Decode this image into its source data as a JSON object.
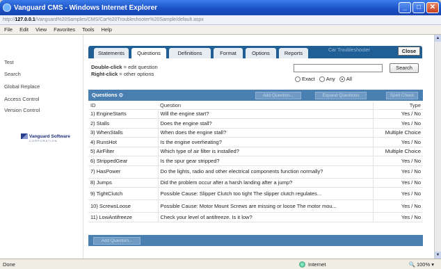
{
  "window": {
    "title": "Vanguard CMS - Windows Internet Explorer"
  },
  "address": {
    "prefix": "http://",
    "host": "127.0.0.1",
    "path": "/Vanguard%20Samples/CMS/Car%20Troubleshooter%20Sample/default.aspx"
  },
  "menu": [
    "File",
    "Edit",
    "View",
    "Favorites",
    "Tools",
    "Help"
  ],
  "sidebar": {
    "items": [
      "Test",
      "Search",
      "Global Replace",
      "Access Control",
      "Version Control"
    ],
    "logo_name": "Vanguard Software",
    "logo_sub": "CORPORATION"
  },
  "tabs": [
    "Statements",
    "Questions",
    "Definitions",
    "Format",
    "Options",
    "Reports"
  ],
  "active_tab": "Questions",
  "header_right": {
    "title": "Car Troubleshooter",
    "close_label": "Close"
  },
  "hints": {
    "line1_bold": "Double-click",
    "line1_rest": " = edit question",
    "line2_bold": "Right-click",
    "line2_rest": " = other options"
  },
  "search": {
    "button": "Search",
    "value": "",
    "options": [
      "Exact",
      "Any",
      "All"
    ],
    "selected": "All"
  },
  "questions_panel": {
    "title": "Questions",
    "buttons": [
      "Add Question...",
      "Expand Questions",
      "Spell Check"
    ],
    "columns": [
      "ID",
      "Question",
      "Type"
    ],
    "rows": [
      {
        "id": "1)  EngineStarts",
        "q": "Will the engine start?",
        "type": "Yes / No"
      },
      {
        "id": "2)  Stalls",
        "q": "Does the engine stall?",
        "type": "Yes / No"
      },
      {
        "id": "3)  WhenStalls",
        "q": "When does the engine stall?",
        "type": "Multiple Choice"
      },
      {
        "id": "4)  RunsHot",
        "q": "Is the engine overheating?",
        "type": "Yes / No"
      },
      {
        "id": "5)  AirFilter",
        "q": "Which type of air filter is installed?",
        "type": "Multiple Choice"
      },
      {
        "id": "6)  StrippedGear",
        "q": "Is the spur gear stripped?",
        "type": "Yes / No"
      },
      {
        "id": "7)  HasPower",
        "q": "Do the lights, radio and other electrical components function normally?",
        "type": "Yes / No"
      },
      {
        "id": "8)  Jumps",
        "q": "Did the problem occur after a harsh landing after a jump?",
        "type": "Yes / No"
      },
      {
        "id": "9)  TightClutch",
        "q": "Possible Cause:  Slipper Clutch too tight The slipper clutch regulates...",
        "type": "Yes / No"
      },
      {
        "id": "10)  ScrewsLoose",
        "q": "Possible Cause:  Motor Mount Screws are missing or loose The motor mou...",
        "type": "Yes / No"
      },
      {
        "id": "11)  LowAntifreeze",
        "q": "Check your level of antifreeze. Is it low?",
        "type": "Yes / No"
      }
    ],
    "footer_button": "Add Question..."
  },
  "status": {
    "left": "Done",
    "zone": "Internet",
    "zoom": "100%"
  }
}
